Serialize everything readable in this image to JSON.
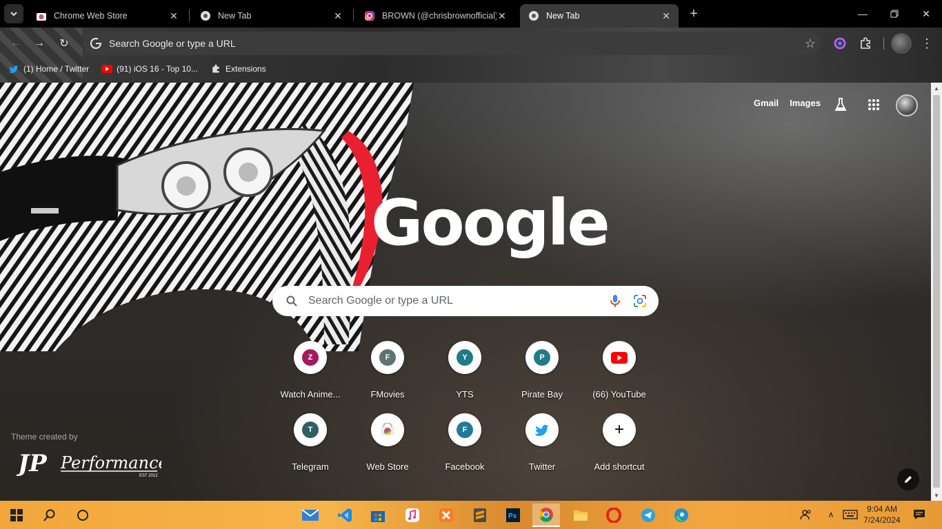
{
  "tabs": [
    {
      "title": "Chrome Web Store",
      "icon": "webstore-icon",
      "active": false
    },
    {
      "title": "New Tab",
      "icon": "chrome-icon",
      "active": false
    },
    {
      "title": "BROWN (@chrisbrownofficial) •",
      "icon": "instagram-icon",
      "active": false
    },
    {
      "title": "New Tab",
      "icon": "chrome-icon",
      "active": true
    }
  ],
  "omnibox": {
    "placeholder": "Search Google or type a URL"
  },
  "bookmarks": [
    {
      "label": "(1) Home / Twitter",
      "icon": "twitter-icon"
    },
    {
      "label": "(91) iOS 16 - Top 10...",
      "icon": "youtube-icon"
    },
    {
      "label": "Extensions",
      "icon": "puzzle-icon"
    }
  ],
  "ntp": {
    "gmail": "Gmail",
    "images": "Images",
    "logo": "Google",
    "search_placeholder": "Search Google or type a URL",
    "theme_credit": "Theme created by",
    "theme_logo": "JP Performance",
    "theme_logo_sub": "EST 2012"
  },
  "shortcuts": [
    {
      "label": "Watch Anime...",
      "letter": "Z",
      "color": "#a21a5a"
    },
    {
      "label": "FMovies",
      "letter": "F",
      "color": "#5f7370"
    },
    {
      "label": "YTS",
      "letter": "Y",
      "color": "#1f7b86"
    },
    {
      "label": "Pirate Bay",
      "letter": "P",
      "color": "#1f7b86"
    },
    {
      "label": "(66) YouTube",
      "letter": "",
      "color": "#ff0000"
    },
    {
      "label": "Telegram",
      "letter": "T",
      "color": "#2f5e66"
    },
    {
      "label": "Web Store",
      "letter": "",
      "color": "#4285f4"
    },
    {
      "label": "Facebook",
      "letter": "F",
      "color": "#1f7b9a"
    },
    {
      "label": "Twitter",
      "letter": "",
      "color": "#1da1f2"
    },
    {
      "label": "Add shortcut",
      "letter": "+",
      "color": "#000000"
    }
  ],
  "clock": {
    "time": "9:04 AM",
    "date": "7/24/2024"
  },
  "colors": {
    "accent_orange": "#f2a63a",
    "google_blue": "#4285f4"
  }
}
